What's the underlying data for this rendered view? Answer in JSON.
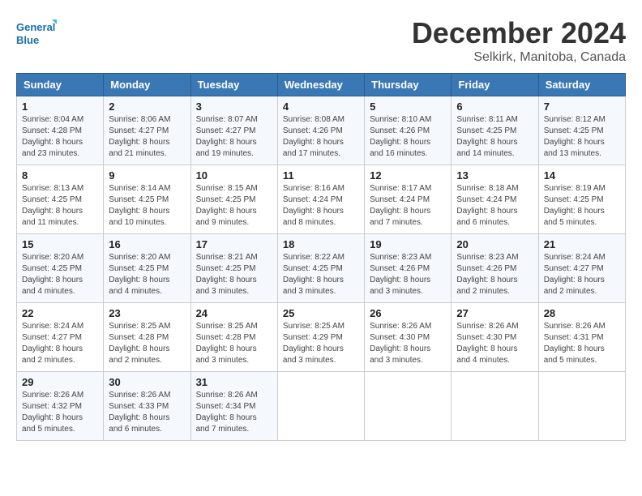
{
  "logo": {
    "line1": "General",
    "line2": "Blue"
  },
  "title": "December 2024",
  "location": "Selkirk, Manitoba, Canada",
  "header": {
    "accent_color": "#3a78b5"
  },
  "days_of_week": [
    "Sunday",
    "Monday",
    "Tuesday",
    "Wednesday",
    "Thursday",
    "Friday",
    "Saturday"
  ],
  "weeks": [
    [
      {
        "num": "1",
        "sunrise": "Sunrise: 8:04 AM",
        "sunset": "Sunset: 4:28 PM",
        "daylight": "Daylight: 8 hours and 23 minutes."
      },
      {
        "num": "2",
        "sunrise": "Sunrise: 8:06 AM",
        "sunset": "Sunset: 4:27 PM",
        "daylight": "Daylight: 8 hours and 21 minutes."
      },
      {
        "num": "3",
        "sunrise": "Sunrise: 8:07 AM",
        "sunset": "Sunset: 4:27 PM",
        "daylight": "Daylight: 8 hours and 19 minutes."
      },
      {
        "num": "4",
        "sunrise": "Sunrise: 8:08 AM",
        "sunset": "Sunset: 4:26 PM",
        "daylight": "Daylight: 8 hours and 17 minutes."
      },
      {
        "num": "5",
        "sunrise": "Sunrise: 8:10 AM",
        "sunset": "Sunset: 4:26 PM",
        "daylight": "Daylight: 8 hours and 16 minutes."
      },
      {
        "num": "6",
        "sunrise": "Sunrise: 8:11 AM",
        "sunset": "Sunset: 4:25 PM",
        "daylight": "Daylight: 8 hours and 14 minutes."
      },
      {
        "num": "7",
        "sunrise": "Sunrise: 8:12 AM",
        "sunset": "Sunset: 4:25 PM",
        "daylight": "Daylight: 8 hours and 13 minutes."
      }
    ],
    [
      {
        "num": "8",
        "sunrise": "Sunrise: 8:13 AM",
        "sunset": "Sunset: 4:25 PM",
        "daylight": "Daylight: 8 hours and 11 minutes."
      },
      {
        "num": "9",
        "sunrise": "Sunrise: 8:14 AM",
        "sunset": "Sunset: 4:25 PM",
        "daylight": "Daylight: 8 hours and 10 minutes."
      },
      {
        "num": "10",
        "sunrise": "Sunrise: 8:15 AM",
        "sunset": "Sunset: 4:25 PM",
        "daylight": "Daylight: 8 hours and 9 minutes."
      },
      {
        "num": "11",
        "sunrise": "Sunrise: 8:16 AM",
        "sunset": "Sunset: 4:24 PM",
        "daylight": "Daylight: 8 hours and 8 minutes."
      },
      {
        "num": "12",
        "sunrise": "Sunrise: 8:17 AM",
        "sunset": "Sunset: 4:24 PM",
        "daylight": "Daylight: 8 hours and 7 minutes."
      },
      {
        "num": "13",
        "sunrise": "Sunrise: 8:18 AM",
        "sunset": "Sunset: 4:24 PM",
        "daylight": "Daylight: 8 hours and 6 minutes."
      },
      {
        "num": "14",
        "sunrise": "Sunrise: 8:19 AM",
        "sunset": "Sunset: 4:25 PM",
        "daylight": "Daylight: 8 hours and 5 minutes."
      }
    ],
    [
      {
        "num": "15",
        "sunrise": "Sunrise: 8:20 AM",
        "sunset": "Sunset: 4:25 PM",
        "daylight": "Daylight: 8 hours and 4 minutes."
      },
      {
        "num": "16",
        "sunrise": "Sunrise: 8:20 AM",
        "sunset": "Sunset: 4:25 PM",
        "daylight": "Daylight: 8 hours and 4 minutes."
      },
      {
        "num": "17",
        "sunrise": "Sunrise: 8:21 AM",
        "sunset": "Sunset: 4:25 PM",
        "daylight": "Daylight: 8 hours and 3 minutes."
      },
      {
        "num": "18",
        "sunrise": "Sunrise: 8:22 AM",
        "sunset": "Sunset: 4:25 PM",
        "daylight": "Daylight: 8 hours and 3 minutes."
      },
      {
        "num": "19",
        "sunrise": "Sunrise: 8:23 AM",
        "sunset": "Sunset: 4:26 PM",
        "daylight": "Daylight: 8 hours and 3 minutes."
      },
      {
        "num": "20",
        "sunrise": "Sunrise: 8:23 AM",
        "sunset": "Sunset: 4:26 PM",
        "daylight": "Daylight: 8 hours and 2 minutes."
      },
      {
        "num": "21",
        "sunrise": "Sunrise: 8:24 AM",
        "sunset": "Sunset: 4:27 PM",
        "daylight": "Daylight: 8 hours and 2 minutes."
      }
    ],
    [
      {
        "num": "22",
        "sunrise": "Sunrise: 8:24 AM",
        "sunset": "Sunset: 4:27 PM",
        "daylight": "Daylight: 8 hours and 2 minutes."
      },
      {
        "num": "23",
        "sunrise": "Sunrise: 8:25 AM",
        "sunset": "Sunset: 4:28 PM",
        "daylight": "Daylight: 8 hours and 2 minutes."
      },
      {
        "num": "24",
        "sunrise": "Sunrise: 8:25 AM",
        "sunset": "Sunset: 4:28 PM",
        "daylight": "Daylight: 8 hours and 3 minutes."
      },
      {
        "num": "25",
        "sunrise": "Sunrise: 8:25 AM",
        "sunset": "Sunset: 4:29 PM",
        "daylight": "Daylight: 8 hours and 3 minutes."
      },
      {
        "num": "26",
        "sunrise": "Sunrise: 8:26 AM",
        "sunset": "Sunset: 4:30 PM",
        "daylight": "Daylight: 8 hours and 3 minutes."
      },
      {
        "num": "27",
        "sunrise": "Sunrise: 8:26 AM",
        "sunset": "Sunset: 4:30 PM",
        "daylight": "Daylight: 8 hours and 4 minutes."
      },
      {
        "num": "28",
        "sunrise": "Sunrise: 8:26 AM",
        "sunset": "Sunset: 4:31 PM",
        "daylight": "Daylight: 8 hours and 5 minutes."
      }
    ],
    [
      {
        "num": "29",
        "sunrise": "Sunrise: 8:26 AM",
        "sunset": "Sunset: 4:32 PM",
        "daylight": "Daylight: 8 hours and 5 minutes."
      },
      {
        "num": "30",
        "sunrise": "Sunrise: 8:26 AM",
        "sunset": "Sunset: 4:33 PM",
        "daylight": "Daylight: 8 hours and 6 minutes."
      },
      {
        "num": "31",
        "sunrise": "Sunrise: 8:26 AM",
        "sunset": "Sunset: 4:34 PM",
        "daylight": "Daylight: 8 hours and 7 minutes."
      },
      null,
      null,
      null,
      null
    ]
  ]
}
